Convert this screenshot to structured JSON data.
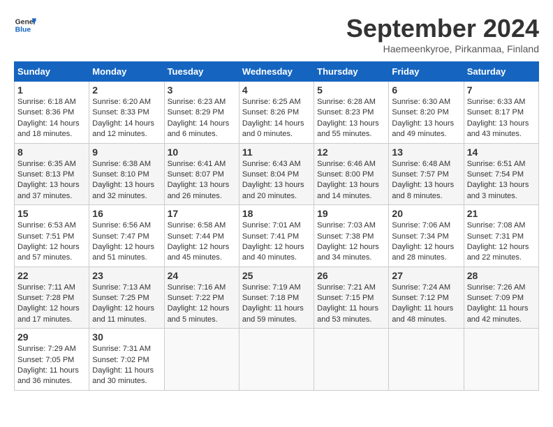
{
  "header": {
    "logo_general": "General",
    "logo_blue": "Blue",
    "month_title": "September 2024",
    "subtitle": "Haemeenkyroe, Pirkanmaa, Finland"
  },
  "weekdays": [
    "Sunday",
    "Monday",
    "Tuesday",
    "Wednesday",
    "Thursday",
    "Friday",
    "Saturday"
  ],
  "weeks": [
    [
      {
        "day": "1",
        "info": "Sunrise: 6:18 AM\nSunset: 8:36 PM\nDaylight: 14 hours\nand 18 minutes."
      },
      {
        "day": "2",
        "info": "Sunrise: 6:20 AM\nSunset: 8:33 PM\nDaylight: 14 hours\nand 12 minutes."
      },
      {
        "day": "3",
        "info": "Sunrise: 6:23 AM\nSunset: 8:29 PM\nDaylight: 14 hours\nand 6 minutes."
      },
      {
        "day": "4",
        "info": "Sunrise: 6:25 AM\nSunset: 8:26 PM\nDaylight: 14 hours\nand 0 minutes."
      },
      {
        "day": "5",
        "info": "Sunrise: 6:28 AM\nSunset: 8:23 PM\nDaylight: 13 hours\nand 55 minutes."
      },
      {
        "day": "6",
        "info": "Sunrise: 6:30 AM\nSunset: 8:20 PM\nDaylight: 13 hours\nand 49 minutes."
      },
      {
        "day": "7",
        "info": "Sunrise: 6:33 AM\nSunset: 8:17 PM\nDaylight: 13 hours\nand 43 minutes."
      }
    ],
    [
      {
        "day": "8",
        "info": "Sunrise: 6:35 AM\nSunset: 8:13 PM\nDaylight: 13 hours\nand 37 minutes."
      },
      {
        "day": "9",
        "info": "Sunrise: 6:38 AM\nSunset: 8:10 PM\nDaylight: 13 hours\nand 32 minutes."
      },
      {
        "day": "10",
        "info": "Sunrise: 6:41 AM\nSunset: 8:07 PM\nDaylight: 13 hours\nand 26 minutes."
      },
      {
        "day": "11",
        "info": "Sunrise: 6:43 AM\nSunset: 8:04 PM\nDaylight: 13 hours\nand 20 minutes."
      },
      {
        "day": "12",
        "info": "Sunrise: 6:46 AM\nSunset: 8:00 PM\nDaylight: 13 hours\nand 14 minutes."
      },
      {
        "day": "13",
        "info": "Sunrise: 6:48 AM\nSunset: 7:57 PM\nDaylight: 13 hours\nand 8 minutes."
      },
      {
        "day": "14",
        "info": "Sunrise: 6:51 AM\nSunset: 7:54 PM\nDaylight: 13 hours\nand 3 minutes."
      }
    ],
    [
      {
        "day": "15",
        "info": "Sunrise: 6:53 AM\nSunset: 7:51 PM\nDaylight: 12 hours\nand 57 minutes."
      },
      {
        "day": "16",
        "info": "Sunrise: 6:56 AM\nSunset: 7:47 PM\nDaylight: 12 hours\nand 51 minutes."
      },
      {
        "day": "17",
        "info": "Sunrise: 6:58 AM\nSunset: 7:44 PM\nDaylight: 12 hours\nand 45 minutes."
      },
      {
        "day": "18",
        "info": "Sunrise: 7:01 AM\nSunset: 7:41 PM\nDaylight: 12 hours\nand 40 minutes."
      },
      {
        "day": "19",
        "info": "Sunrise: 7:03 AM\nSunset: 7:38 PM\nDaylight: 12 hours\nand 34 minutes."
      },
      {
        "day": "20",
        "info": "Sunrise: 7:06 AM\nSunset: 7:34 PM\nDaylight: 12 hours\nand 28 minutes."
      },
      {
        "day": "21",
        "info": "Sunrise: 7:08 AM\nSunset: 7:31 PM\nDaylight: 12 hours\nand 22 minutes."
      }
    ],
    [
      {
        "day": "22",
        "info": "Sunrise: 7:11 AM\nSunset: 7:28 PM\nDaylight: 12 hours\nand 17 minutes."
      },
      {
        "day": "23",
        "info": "Sunrise: 7:13 AM\nSunset: 7:25 PM\nDaylight: 12 hours\nand 11 minutes."
      },
      {
        "day": "24",
        "info": "Sunrise: 7:16 AM\nSunset: 7:22 PM\nDaylight: 12 hours\nand 5 minutes."
      },
      {
        "day": "25",
        "info": "Sunrise: 7:19 AM\nSunset: 7:18 PM\nDaylight: 11 hours\nand 59 minutes."
      },
      {
        "day": "26",
        "info": "Sunrise: 7:21 AM\nSunset: 7:15 PM\nDaylight: 11 hours\nand 53 minutes."
      },
      {
        "day": "27",
        "info": "Sunrise: 7:24 AM\nSunset: 7:12 PM\nDaylight: 11 hours\nand 48 minutes."
      },
      {
        "day": "28",
        "info": "Sunrise: 7:26 AM\nSunset: 7:09 PM\nDaylight: 11 hours\nand 42 minutes."
      }
    ],
    [
      {
        "day": "29",
        "info": "Sunrise: 7:29 AM\nSunset: 7:05 PM\nDaylight: 11 hours\nand 36 minutes."
      },
      {
        "day": "30",
        "info": "Sunrise: 7:31 AM\nSunset: 7:02 PM\nDaylight: 11 hours\nand 30 minutes."
      },
      {
        "day": "",
        "info": ""
      },
      {
        "day": "",
        "info": ""
      },
      {
        "day": "",
        "info": ""
      },
      {
        "day": "",
        "info": ""
      },
      {
        "day": "",
        "info": ""
      }
    ]
  ]
}
